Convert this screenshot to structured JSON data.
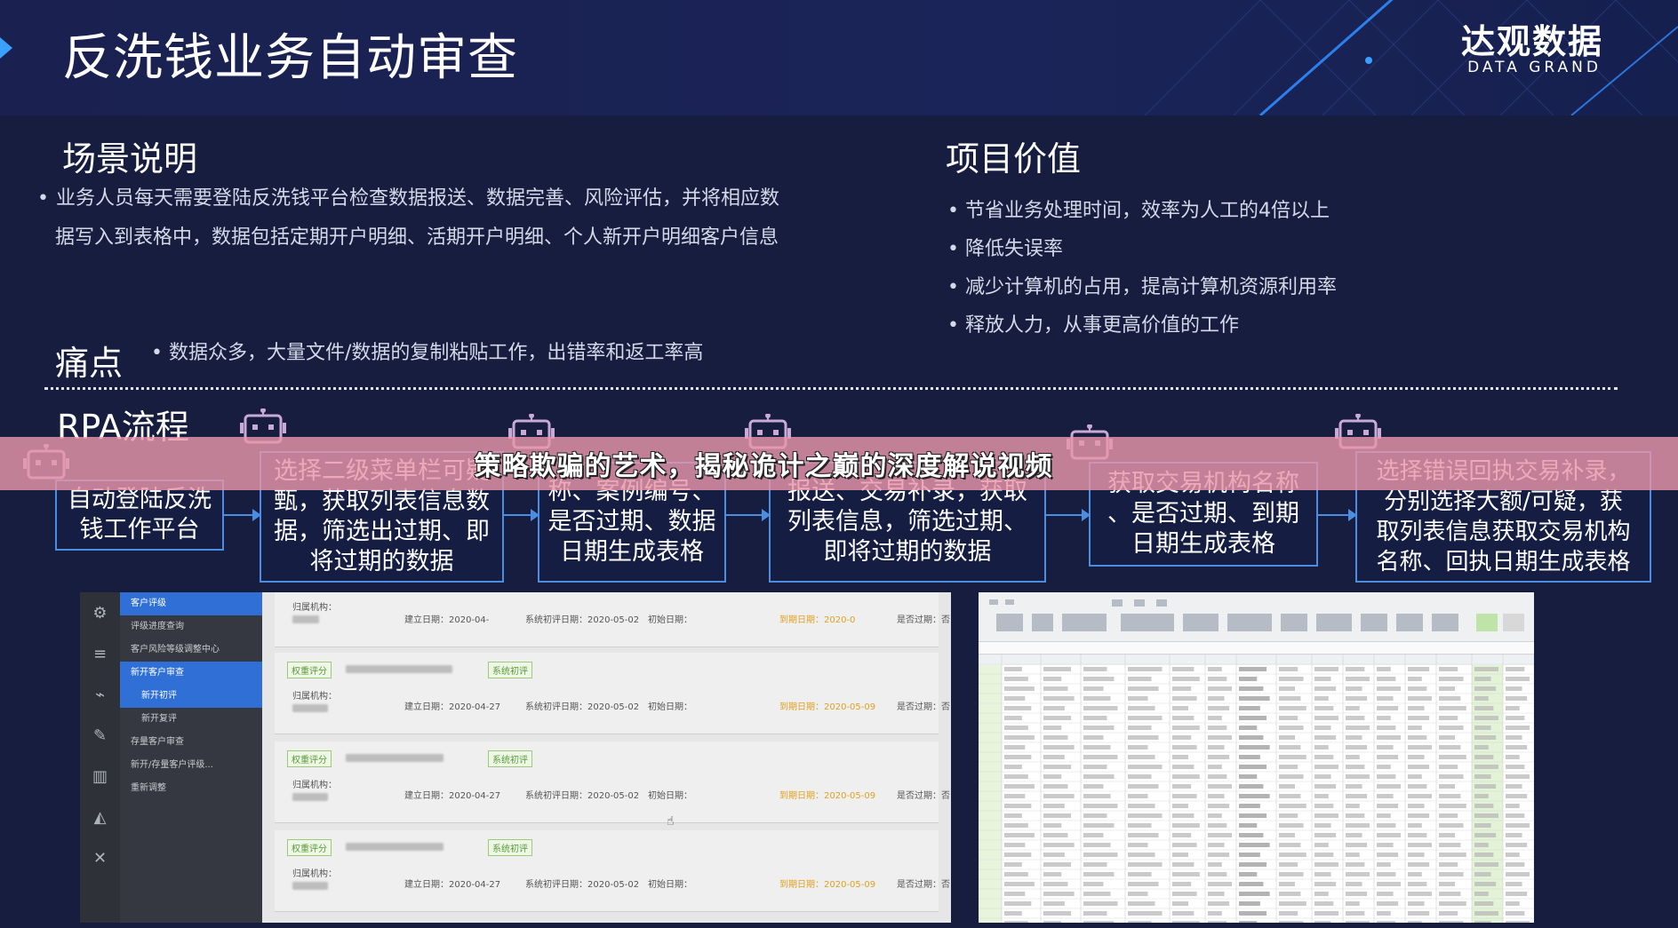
{
  "header": {
    "title": "反洗钱业务自动审查",
    "logo_cn": "达观数据",
    "logo_en": "DATA GRAND"
  },
  "scene": {
    "title": "场景说明",
    "text_line1": "业务人员每天需要登陆反洗钱平台检查数据报送、数据完善、风险评估，并将相应数",
    "text_line2": "据写入到表格中，数据包括定期开户明细、活期开户明细、个人新开户明细客户信息"
  },
  "value": {
    "title": "项目价值",
    "items": [
      "节省业务处理时间，效率为人工的4倍以上",
      "降低失误率",
      "减少计算机的占用，提高计算机资源利用率",
      "释放人力，从事更高价值的工作"
    ]
  },
  "pain": {
    "title": "痛点",
    "text": "数据众多，大量文件/数据的复制粘贴工作，出错率和返工率高"
  },
  "rpa": {
    "title": "RPA流程",
    "steps": [
      "自动登陆反洗\n钱工作平台",
      "选择二级菜单栏可疑\n甄，获取列表信息数\n据，筛选出过期、即\n将过期的数据",
      "称、案例编号、\n是否过期、数据\n日期生成表格",
      "报送、交易补录，获取\n列表信息，筛选过期、\n即将过期的数据",
      "获取交易机构名称\n、是否过期、到期\n日期生成表格",
      "选择错误回执交易补录，\n分别选择大额/可疑，获\n取列表信息获取交易机构\n名称、回执日期生成表格"
    ]
  },
  "banner": {
    "text": "策略欺骗的艺术，揭秘诡计之巅的深度解说视频"
  },
  "screenshot1": {
    "menu": [
      "客户评级",
      "评级进度查询",
      "客户风险等级调整中心",
      "新开客户审查",
      "新开初评",
      "新开复评",
      "存量客户审查",
      "新开/存量客户评级...",
      "重新调整"
    ],
    "tag_label": "权重评分",
    "tag_system": "系统初评",
    "rows": [
      {
        "org": "归属机构：",
        "build": "建立日期：2020-04-",
        "sys": "系统初评日期：2020-05-02",
        "init": "初始日期：",
        "due": "到期日期：2020-0",
        "expired": "是否过期：否"
      },
      {
        "org": "归属机构：",
        "build": "建立日期：2020-04-27",
        "sys": "系统初评日期：2020-05-02",
        "init": "初始日期：",
        "due": "到期日期：2020-05-09",
        "expired": "是否过期：否"
      },
      {
        "org": "归属机构：",
        "build": "建立日期：2020-04-27",
        "sys": "系统初评日期：2020-05-02",
        "init": "初始日期：",
        "due": "到期日期：2020-05-09",
        "expired": "是否过期：否"
      },
      {
        "org": "归属机构：",
        "build": "建立日期：2020-04-27",
        "sys": "系统初评日期：2020-05-02",
        "init": "初始日期：",
        "due": "到期日期：2020-05-09",
        "expired": "是否过期：否"
      }
    ]
  },
  "colors": {
    "background": "#161d3f",
    "accent": "#4b8de0",
    "banner": "#e896aa"
  }
}
